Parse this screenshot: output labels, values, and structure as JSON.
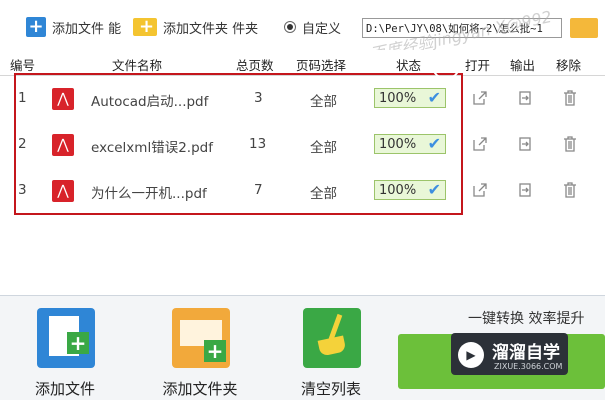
{
  "toolbar": {
    "add_file_label": "添加文件 能",
    "add_folder_label": "添加文件夹 件夹",
    "custom_label": "自定义",
    "path_value": "D:\\Per\\JY\\08\\如何将~2\\怎么批~1"
  },
  "watermark": "百度经验jingyan X@992",
  "columns": {
    "index": "编号",
    "filename": "文件名称",
    "pages": "总页数",
    "page_select": "页码选择",
    "status": "状态",
    "open": "打开",
    "export": "输出",
    "remove": "移除"
  },
  "files": [
    {
      "index": "1",
      "name": "Autocad启动...pdf",
      "pages": "3",
      "page_select": "全部",
      "status": "100%"
    },
    {
      "index": "2",
      "name": "excelxml错误2.pdf",
      "pages": "13",
      "page_select": "全部",
      "status": "100%"
    },
    {
      "index": "3",
      "name": "为什么一开机...pdf",
      "pages": "7",
      "page_select": "全部",
      "status": "100%"
    }
  ],
  "bottom": {
    "add_file": "添加文件",
    "add_folder": "添加文件夹",
    "clear_list": "清空列表",
    "slogan": "一键转换 效率提升"
  },
  "brand": {
    "name": "溜溜自学",
    "url": "ZIXUE.3066.COM"
  },
  "icons": {
    "pdf": "pdf-icon",
    "open": "open-icon",
    "export": "export-icon",
    "remove": "trash-icon",
    "status_check": "check-icon"
  },
  "colors": {
    "highlight": "#c4161c",
    "pdf_red": "#d8232a",
    "accent_blue": "#2f86d6",
    "convert_green": "#6cc03a"
  }
}
